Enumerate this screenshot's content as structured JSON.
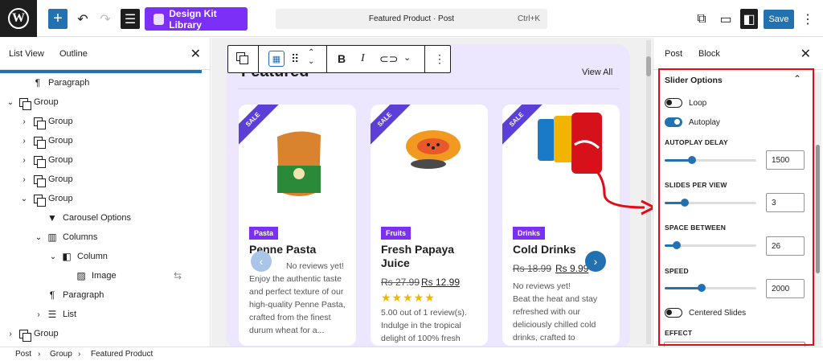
{
  "topbar": {
    "logo_glyph": "W",
    "design_kit_label": "Design Kit Library",
    "document_title": "Featured Product · Post",
    "shortcut": "Ctrl+K",
    "save_label": "Save"
  },
  "left_panel": {
    "tabs": [
      "List View",
      "Outline"
    ],
    "items": [
      {
        "label": "Paragraph"
      },
      {
        "label": "Group"
      },
      {
        "label": "Group"
      },
      {
        "label": "Group"
      },
      {
        "label": "Group"
      },
      {
        "label": "Group"
      },
      {
        "label": "Group"
      },
      {
        "label": "Carousel Options"
      },
      {
        "label": "Columns"
      },
      {
        "label": "Column"
      },
      {
        "label": "Image"
      },
      {
        "label": "Paragraph"
      },
      {
        "label": "List"
      },
      {
        "label": "Group"
      }
    ]
  },
  "canvas": {
    "heading": "Featured",
    "view_all": "View All",
    "cards": [
      {
        "badge": "SALE",
        "category": "Pasta",
        "title": "Penne Pasta",
        "reviews": "No reviews yet!",
        "desc": "Enjoy the authentic taste and perfect texture of our high-quality Penne Pasta, crafted from the finest durum wheat for a..."
      },
      {
        "badge": "SALE",
        "category": "Fruits",
        "title_line1": "Fresh Papaya",
        "title_line2": "Juice",
        "old_price": "Rs 27.99",
        "new_price": "Rs 12.99",
        "stars": "★★★★★",
        "reviews": "5.00 out of 1 review(s).",
        "desc": "Indulge in the tropical delight of 100% fresh"
      },
      {
        "badge": "SALE",
        "category": "Drinks",
        "title": "Cold Drinks",
        "old_price": "Rs 18.99",
        "new_price": "Rs 9.99",
        "reviews": "No reviews yet!",
        "desc": "Beat the heat and stay refreshed with our deliciously chilled cold drinks, crafted to"
      }
    ]
  },
  "sidebar": {
    "tabs": [
      "Post",
      "Block"
    ],
    "section_title": "Slider Options",
    "loop_label": "Loop",
    "loop_on": false,
    "autoplay_label": "Autoplay",
    "autoplay_on": true,
    "autoplay_delay_label": "AUTOPLAY DELAY",
    "autoplay_delay": "1500",
    "slides_per_view_label": "SLIDES PER VIEW",
    "slides_per_view": "3",
    "space_between_label": "SPACE BETWEEN",
    "space_between": "26",
    "speed_label": "SPEED",
    "speed": "2000",
    "centered_label": "Centered Slides",
    "centered_on": false,
    "effect_label": "EFFECT"
  },
  "breadcrumb": [
    "Post",
    "Group",
    "Featured Product"
  ],
  "colors": {
    "accent": "#2271b1",
    "purple": "#7b2ff7",
    "highlight_red": "#e50914"
  }
}
